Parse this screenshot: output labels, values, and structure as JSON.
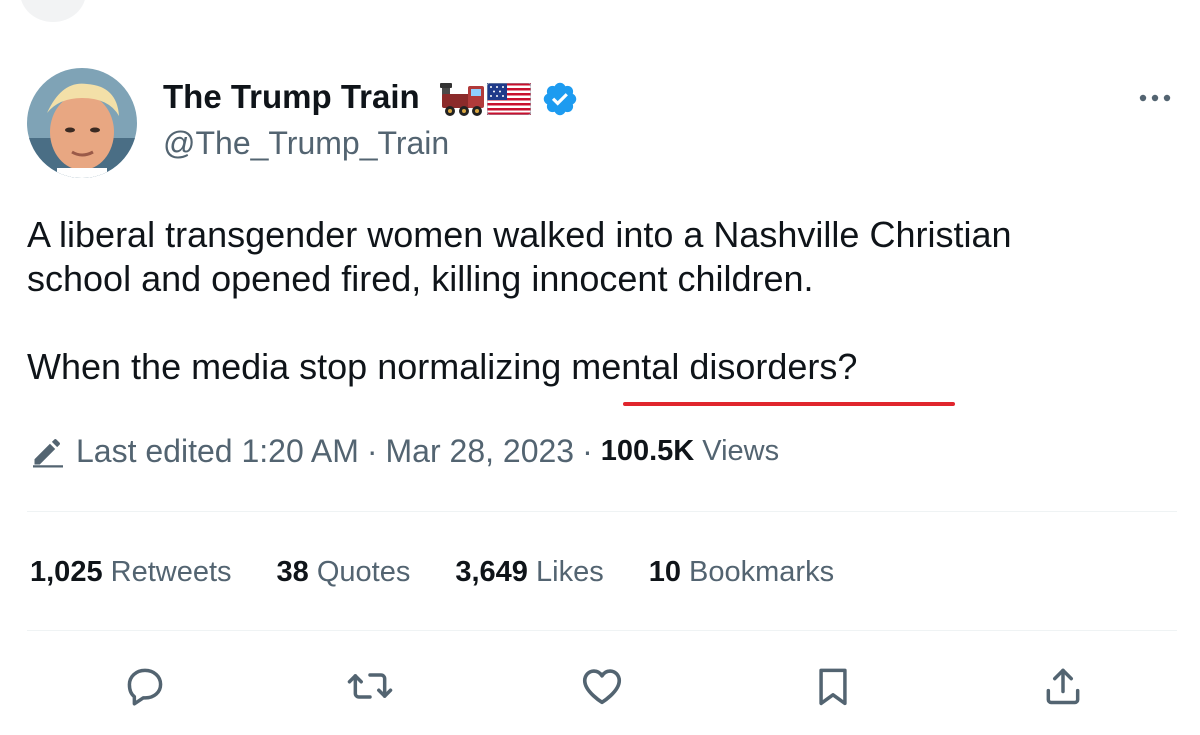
{
  "author": {
    "name": "The Trump Train",
    "handle": "@The_Trump_Train",
    "verified": true,
    "name_emojis": [
      "train-emoji",
      "us-flag-emoji"
    ]
  },
  "tweet": {
    "text": "A liberal transgender women walked into a Nashville Christian\nschool and opened fired, killing innocent children.\n\nWhen the media stop normalizing mental disorders?",
    "annotation_color": "#e0252d"
  },
  "edit_info": {
    "edited_label": "Last edited 1:20 AM",
    "separator": "·",
    "date": "Mar 28, 2023",
    "views_count": "100.5K",
    "views_label": "Views"
  },
  "stats": [
    {
      "count": "1,025",
      "label": "Retweets"
    },
    {
      "count": "38",
      "label": "Quotes"
    },
    {
      "count": "3,649",
      "label": "Likes"
    },
    {
      "count": "10",
      "label": "Bookmarks"
    }
  ],
  "actions": [
    "reply-icon",
    "retweet-icon",
    "like-icon",
    "bookmark-icon",
    "share-icon"
  ],
  "colors": {
    "verified_blue": "#1d9bf0",
    "secondary_text": "#536471",
    "primary_text": "#0f1419"
  }
}
